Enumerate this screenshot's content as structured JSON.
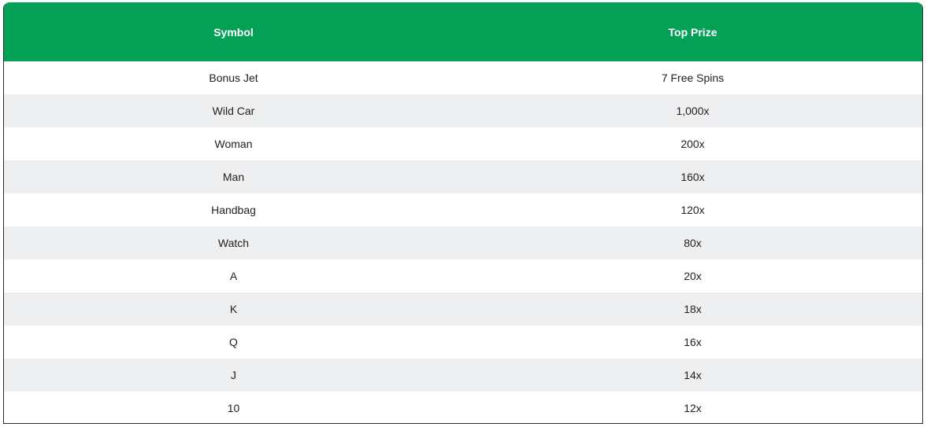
{
  "table": {
    "headers": [
      "Symbol",
      "Top Prize"
    ],
    "rows": [
      [
        "Bonus Jet",
        "7 Free Spins"
      ],
      [
        "Wild Car",
        "1,000x"
      ],
      [
        "Woman",
        "200x"
      ],
      [
        "Man",
        "160x"
      ],
      [
        "Handbag",
        "120x"
      ],
      [
        "Watch",
        "80x"
      ],
      [
        "A",
        "20x"
      ],
      [
        "K",
        "18x"
      ],
      [
        "Q",
        "16x"
      ],
      [
        "J",
        "14x"
      ],
      [
        "10",
        "12x"
      ]
    ]
  },
  "colors": {
    "header_bg": "#03a056",
    "header_text": "#ffffff",
    "row_alt_bg": "#eeeff1"
  }
}
